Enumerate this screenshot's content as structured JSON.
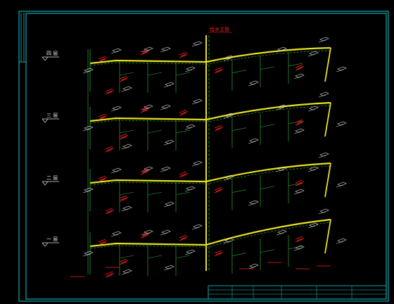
{
  "drawing": {
    "background": "#000000",
    "colors": {
      "frame": "#17c8d0",
      "pipe_main": "#e8e020",
      "pipe_green": "#2aa83a",
      "label_red": "#ff2020",
      "label_white": "#d8d8d8",
      "level_white": "#e0e0e0"
    },
    "floor_levels": [
      {
        "label": "四 层"
      },
      {
        "label": "三 层"
      },
      {
        "label": "二 层"
      },
      {
        "label": "一 层"
      }
    ],
    "riser_label": "给水立管",
    "title_block": {
      "visible": true
    }
  }
}
